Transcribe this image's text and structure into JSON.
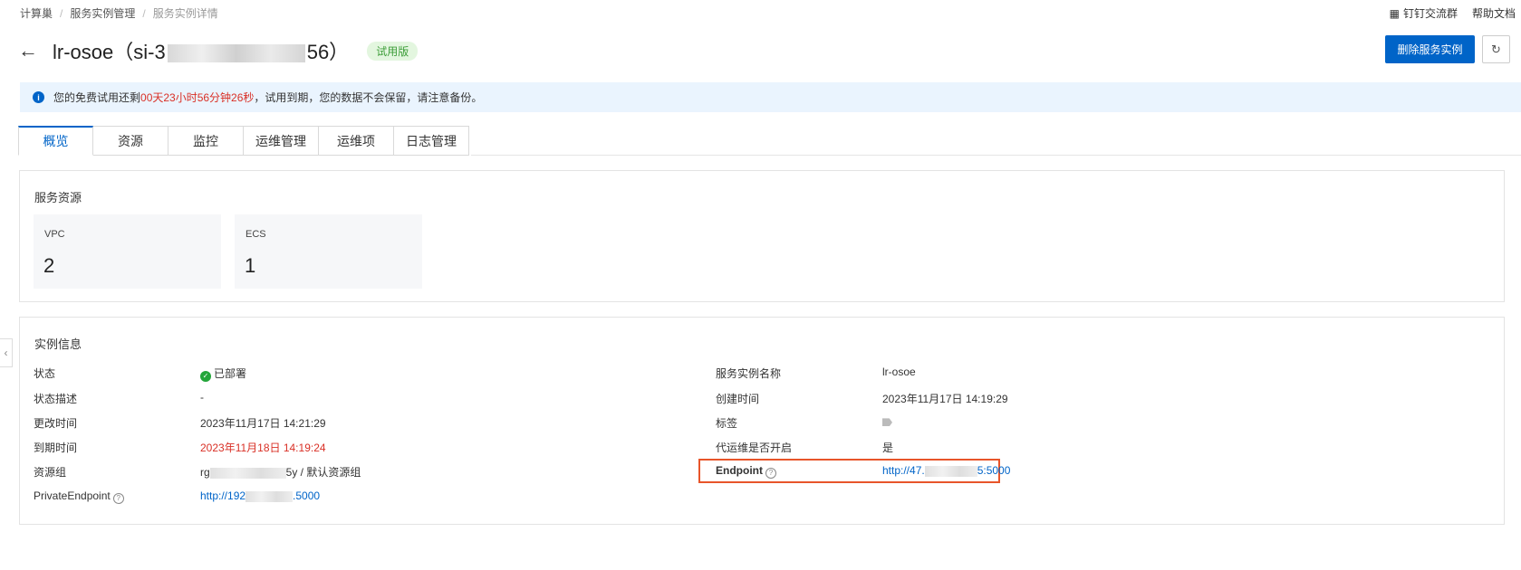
{
  "breadcrumb": [
    "计算巢",
    "服务实例管理",
    "服务实例详情"
  ],
  "topright": {
    "dingtalk": "钉钉交流群",
    "help": "帮助文档"
  },
  "header": {
    "title_prefix": "lr-osoe（si-3",
    "title_suffix": "56）",
    "badge": "试用版",
    "delete_button": "删除服务实例",
    "refresh_icon": "refresh-icon"
  },
  "notice": {
    "prefix": "您的免费试用还剩 ",
    "countdown": "00天23小时56分钟26秒",
    "suffix": " ，试用到期，您的数据不会保留，请注意备份。"
  },
  "tabs": [
    "概览",
    "资源",
    "监控",
    "运维管理",
    "运维项",
    "日志管理"
  ],
  "resources": {
    "title": "服务资源",
    "items": [
      {
        "label": "VPC",
        "value": "2"
      },
      {
        "label": "ECS",
        "value": "1"
      }
    ]
  },
  "instance": {
    "title": "实例信息",
    "left": {
      "status_label": "状态",
      "status_value": "已部署",
      "desc_label": "状态描述",
      "desc_value": "-",
      "modified_label": "更改时间",
      "modified_value": "2023年11月17日 14:21:29",
      "expire_label": "到期时间",
      "expire_value": "2023年11月18日 14:19:24",
      "rg_label": "资源组",
      "rg_prefix": "rg",
      "rg_suffix": "5y / 默认资源组",
      "private_label": "PrivateEndpoint",
      "private_prefix": "http://192",
      "private_suffix": ".5000"
    },
    "right": {
      "name_label": "服务实例名称",
      "name_value": "lr-osoe",
      "created_label": "创建时间",
      "created_value": "2023年11月17日 14:19:29",
      "tag_label": "标签",
      "ops_label": "代运维是否开启",
      "ops_value": "是",
      "endpoint_label": "Endpoint",
      "endpoint_prefix": "http://47.",
      "endpoint_suffix": "5:5000"
    }
  },
  "colors": {
    "primary": "#0064c8",
    "danger": "#d93026",
    "success": "#23a53a",
    "highlight": "#e8552a"
  }
}
